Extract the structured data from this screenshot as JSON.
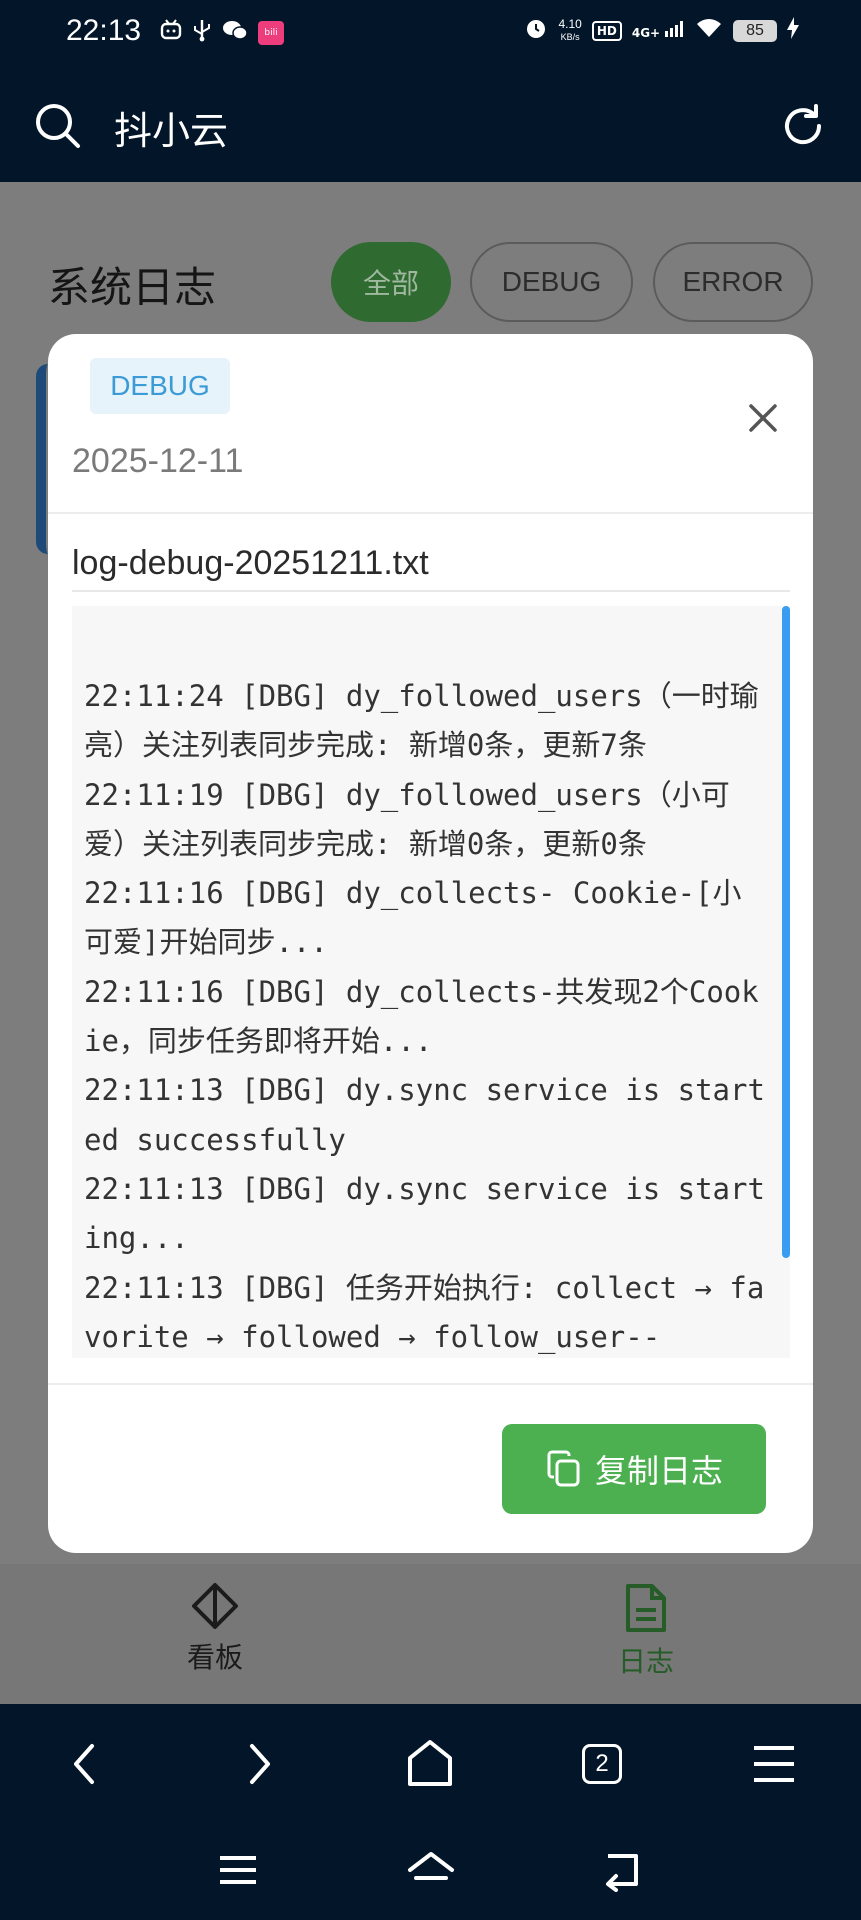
{
  "status_bar": {
    "time": "22:13",
    "net_speed_value": "4.10",
    "net_speed_unit": "KB/s",
    "hd_label": "HD",
    "signal_label": "4G+",
    "battery": "85",
    "app_badge": "bili"
  },
  "header": {
    "title": "抖小云",
    "search_icon": "search-icon",
    "refresh_icon": "refresh-icon"
  },
  "page": {
    "title": "系统日志",
    "filters": [
      "全部",
      "DEBUG",
      "ERROR"
    ],
    "active_filter": "全部"
  },
  "modal": {
    "level_tag": "DEBUG",
    "date": "2025-12-11",
    "filename": "log-debug-20251211.txt",
    "log_lines": [
      "22:11:24 [DBG] dy_followed_users（一时瑜亮）关注列表同步完成: 新增0条，更新7条",
      "22:11:19 [DBG] dy_followed_users（小可爱）关注列表同步完成: 新增0条，更新0条",
      "22:11:16 [DBG] dy_collects- Cookie-[小可爱]开始同步...",
      "22:11:16 [DBG] dy_collects-共发现2个Cookie，同步任务即将开始...",
      "22:11:13 [DBG] dy.sync service is started successfully",
      "22:11:13 [DBG] dy.sync service is starting...",
      "22:11:13 [DBG] 任务开始执行: collect → favorite → followed → follow_user--"
    ],
    "copy_button": "复制日志",
    "accent_color": "#4caf50",
    "tag_color": "#3b9bd6"
  },
  "bottom_nav": {
    "items": [
      {
        "label": "看板",
        "icon": "diamond-icon"
      },
      {
        "label": "日志",
        "icon": "document-icon"
      }
    ],
    "active": "日志"
  },
  "browser_bar": {
    "tab_count": "2"
  }
}
